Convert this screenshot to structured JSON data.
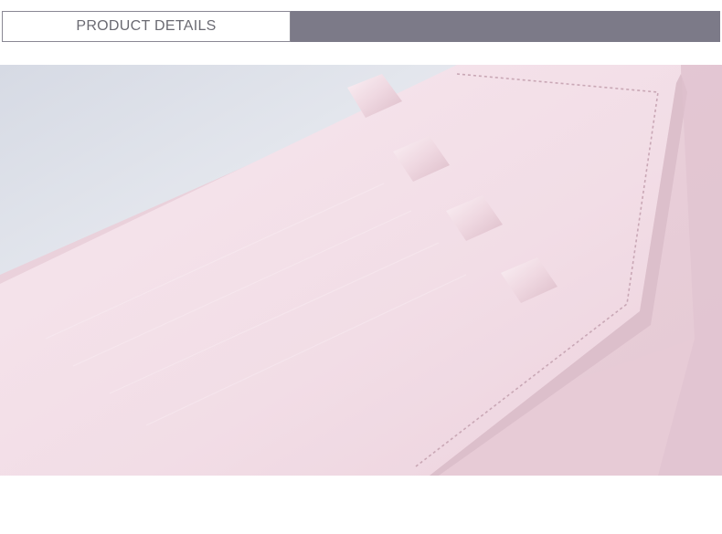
{
  "header": {
    "title": "PRODUCT DETAILS",
    "accent_color": "#7c7a88",
    "border_color": "#8a8894"
  },
  "photo": {
    "subject": "pink-wallet-closeup",
    "colors": {
      "leather": "#f2dde6",
      "leather_shadow": "#e3c6d2",
      "background": "#e8eaf0"
    }
  }
}
